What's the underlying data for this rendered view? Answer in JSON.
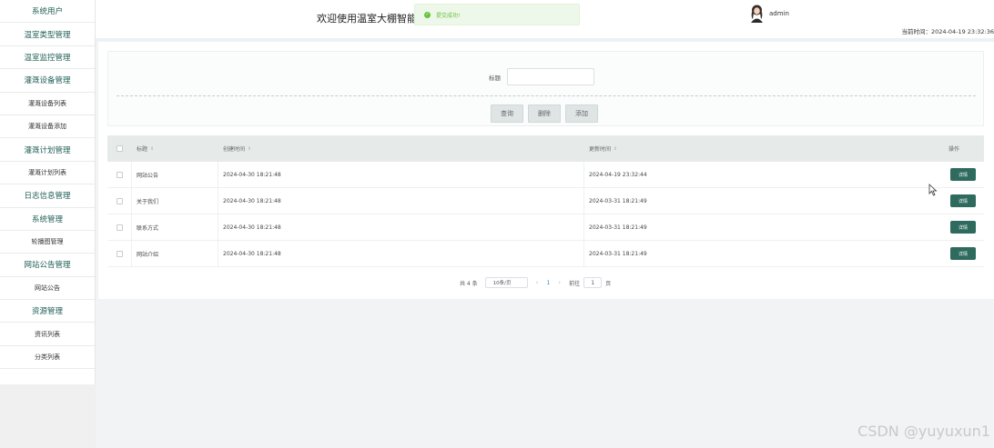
{
  "sidebar": {
    "items": [
      {
        "label": "系统用户",
        "type": "group"
      },
      {
        "label": "温室类型管理",
        "type": "group"
      },
      {
        "label": "温室监控管理",
        "type": "group"
      },
      {
        "label": "灌溉设备管理",
        "type": "group"
      },
      {
        "label": "灌溉设备列表",
        "type": "sub"
      },
      {
        "label": "灌溉设备添加",
        "type": "sub"
      },
      {
        "label": "灌溉计划管理",
        "type": "group"
      },
      {
        "label": "灌溉计划列表",
        "type": "sub"
      },
      {
        "label": "日志信息管理",
        "type": "group"
      },
      {
        "label": "系统管理",
        "type": "group"
      },
      {
        "label": "轮播图管理",
        "type": "sub"
      },
      {
        "label": "网站公告管理",
        "type": "group"
      },
      {
        "label": "网站公告",
        "type": "sub"
      },
      {
        "label": "资源管理",
        "type": "group"
      },
      {
        "label": "资讯列表",
        "type": "sub"
      },
      {
        "label": "分类列表",
        "type": "sub"
      }
    ]
  },
  "header": {
    "welcome": "欢迎使用温室大棚智能",
    "toast": "提交成功!",
    "username": "admin",
    "time": "当前时间：2024-04-19 23:32:36"
  },
  "search": {
    "label": "标题",
    "value": "",
    "buttons": {
      "query": "查询",
      "delete": "删除",
      "add": "添加"
    }
  },
  "table": {
    "headers": {
      "title": "标题",
      "created": "创建时间",
      "updated": "更新时间",
      "action": "操作"
    },
    "rows": [
      {
        "title": "网站公告",
        "created": "2024-04-30 18:21:48",
        "updated": "2024-04-19 23:32:44",
        "action": "详情"
      },
      {
        "title": "关于我们",
        "created": "2024-04-30 18:21:48",
        "updated": "2024-03-31 18:21:49",
        "action": "详情"
      },
      {
        "title": "联系方式",
        "created": "2024-04-30 18:21:48",
        "updated": "2024-03-31 18:21:49",
        "action": "详情"
      },
      {
        "title": "网站介绍",
        "created": "2024-04-30 18:21:48",
        "updated": "2024-03-31 18:21:49",
        "action": "详情"
      }
    ]
  },
  "pagination": {
    "total": "共 4 条",
    "page_size": "10条/页",
    "current": "1",
    "goto_prefix": "前往",
    "goto_value": "1",
    "goto_suffix": "页"
  },
  "watermark": "CSDN @yuyuxun1",
  "colors": {
    "accent": "#2e6b5e",
    "success": "#67c23a",
    "header_bg": "#e6ebe9"
  }
}
